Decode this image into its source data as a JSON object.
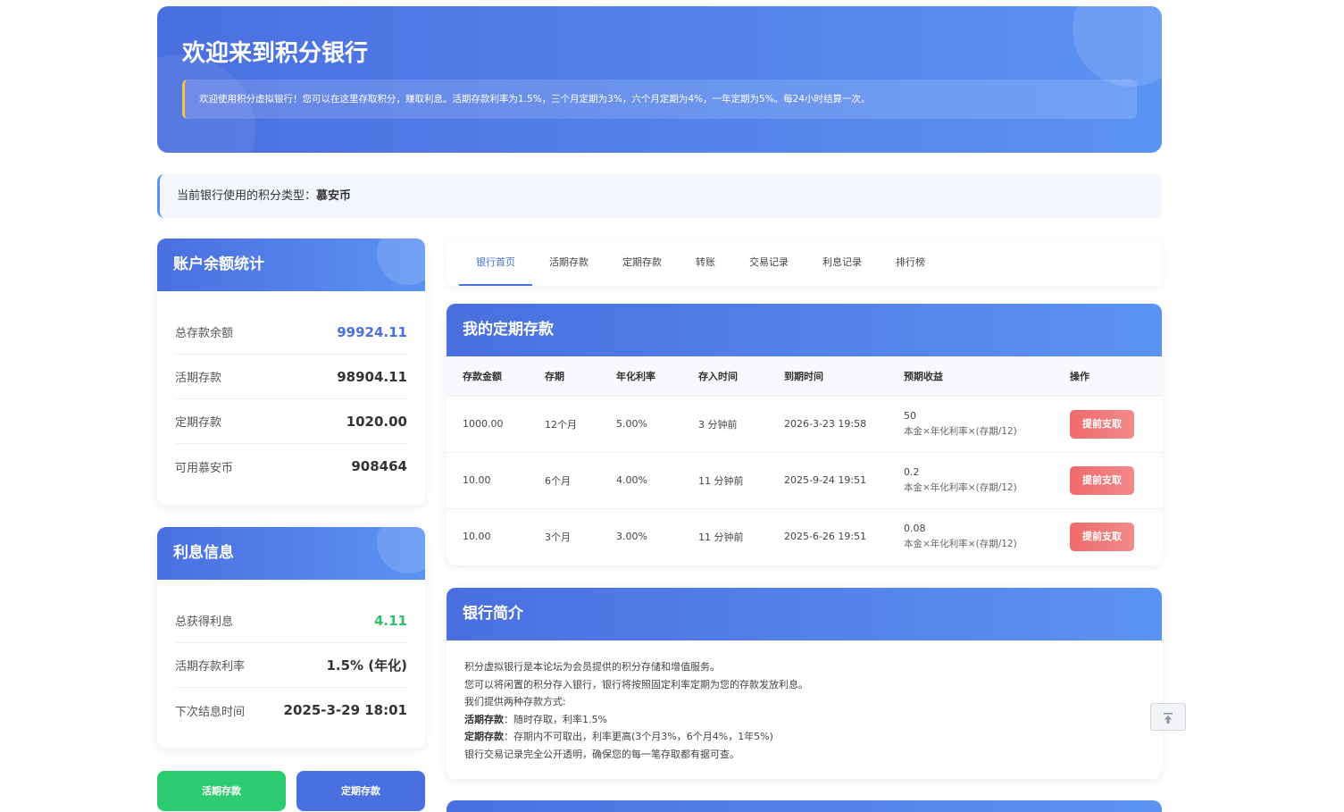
{
  "hero": {
    "title": "欢迎来到积分银行",
    "notice": "欢迎使用积分虚拟银行！您可以在这里存取积分，赚取利息。活期存款利率为1.5%，三个月定期为3%，六个月定期为4%，一年定期为5%。每24小时结算一次。"
  },
  "points_type": {
    "label": "当前银行使用的积分类型：",
    "value": "慕安币"
  },
  "balance": {
    "title": "账户余额统计",
    "rows": [
      {
        "label": "总存款余额",
        "value": "99924.11"
      },
      {
        "label": "活期存款",
        "value": "98904.11"
      },
      {
        "label": "定期存款",
        "value": "1020.00"
      },
      {
        "label": "可用慕安币",
        "value": "908464"
      }
    ]
  },
  "interest": {
    "title": "利息信息",
    "rows": [
      {
        "label": "总获得利息",
        "value": "4.11"
      },
      {
        "label": "活期存款利率",
        "value": "1.5% (年化)"
      },
      {
        "label": "下次结息时间",
        "value": "2025-3-29 18:01"
      }
    ]
  },
  "actions": {
    "demand": "活期存款",
    "fixed": "定期存款"
  },
  "tabs": [
    "银行首页",
    "活期存款",
    "定期存款",
    "转账",
    "交易记录",
    "利息记录",
    "排行榜"
  ],
  "fixed_deposits": {
    "title": "我的定期存款",
    "headers": [
      "存款金额",
      "存期",
      "年化利率",
      "存入时间",
      "到期时间",
      "预期收益",
      "操作"
    ],
    "rows": [
      {
        "amount": "1000.00",
        "term": "12个月",
        "rate": "5.00%",
        "deposit_time": "3 分钟前",
        "due": "2026-3-23 19:58",
        "earn": "50",
        "formula": "本金×年化利率×(存期/12)",
        "action": "提前支取"
      },
      {
        "amount": "10.00",
        "term": "6个月",
        "rate": "4.00%",
        "deposit_time": "11 分钟前",
        "due": "2025-9-24 19:51",
        "earn": "0.2",
        "formula": "本金×年化利率×(存期/12)",
        "action": "提前支取"
      },
      {
        "amount": "10.00",
        "term": "3个月",
        "rate": "3.00%",
        "deposit_time": "11 分钟前",
        "due": "2025-6-26 19:51",
        "earn": "0.08",
        "formula": "本金×年化利率×(存期/12)",
        "action": "提前支取"
      }
    ]
  },
  "intro": {
    "title": "银行简介",
    "line1": "积分虚拟银行是本论坛为会员提供的积分存储和增值服务。",
    "line2": "您可以将闲置的积分存入银行，银行将按照固定利率定期为您的存款发放利息。",
    "line3": "我们提供两种存款方式:",
    "demand_label": "活期存款",
    "demand_text": "：随时存取，利率1.5%",
    "fixed_label": "定期存款",
    "fixed_text": "：存期内不可取出，利率更高(3个月3%，6个月4%，1年5%)",
    "line6": "银行交易记录完全公开透明，确保您的每一笔存取都有据可查。"
  },
  "colors": {
    "accent": "#4a6fe0",
    "green": "#2ec26a",
    "red": "#f06a6a"
  }
}
